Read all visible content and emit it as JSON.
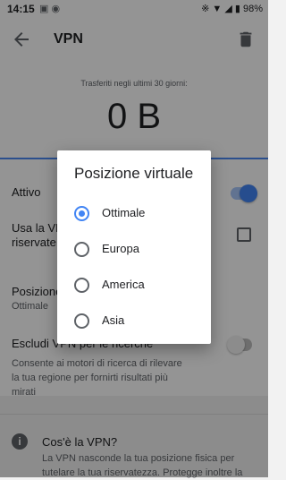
{
  "status_bar": {
    "time": "14:15",
    "battery": "98%"
  },
  "app_bar": {
    "title": "VPN"
  },
  "stats": {
    "caption": "Trasferiti negli ultimi 30 giorni:",
    "value": "0 B"
  },
  "settings": {
    "active": {
      "label": "Attivo",
      "enabled": true
    },
    "use_vpn": {
      "label_line1": "Usa la VPN",
      "label_line2": "riservate",
      "checked": false
    },
    "position": {
      "label": "Posizione virtuale",
      "value": "Ottimale"
    },
    "exclude": {
      "label": "Escludi VPN per le ricerche",
      "enabled": false,
      "desc_line1": "Consente ai motori di ricerca di rilevare",
      "desc_line2": "la tua regione per fornirti risultati più",
      "desc_line3": "mirati"
    }
  },
  "info": {
    "title": "Cos'è la VPN?",
    "line1": "La VPN nasconde la tua posizione fisica per",
    "line2": "tutelare la tua riservatezza. Protegge inoltre la"
  },
  "dialog": {
    "title": "Posizione virtuale",
    "options": [
      {
        "label": "Ottimale",
        "selected": true
      },
      {
        "label": "Europa",
        "selected": false
      },
      {
        "label": "America",
        "selected": false
      },
      {
        "label": "Asia",
        "selected": false
      }
    ]
  },
  "colors": {
    "accent": "#4285f4",
    "scrim": "rgba(0,0,0,0.42)",
    "surface": "#ffffff"
  }
}
